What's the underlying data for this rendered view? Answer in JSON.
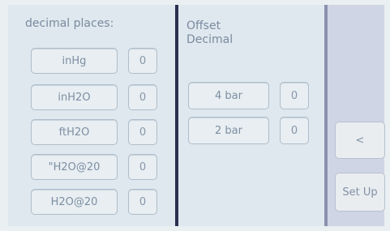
{
  "left_panel": {
    "title": "decimal places:",
    "rows": [
      {
        "unit": "inHg",
        "value": "0"
      },
      {
        "unit": "inH2O",
        "value": "0"
      },
      {
        "unit": "ftH2O",
        "value": "0"
      },
      {
        "unit": "\"H2O@20",
        "value": "0"
      },
      {
        "unit": "H2O@20",
        "value": "0"
      }
    ]
  },
  "mid_panel": {
    "title_line1": "Offset",
    "title_line2": "Decimal",
    "rows": [
      {
        "unit": "4 bar",
        "value": "0"
      },
      {
        "unit": "2 bar",
        "value": "0"
      }
    ]
  },
  "right_bar": {
    "back_label": "<",
    "setup_label": "Set Up"
  }
}
